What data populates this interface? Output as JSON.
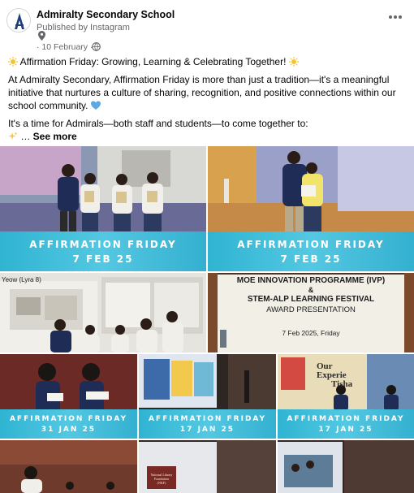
{
  "post": {
    "author": "Admiralty Secondary School",
    "publisher": "Published by Instagram",
    "date": "· 10 February ·",
    "more_icon": "more-options-icon",
    "paragraph_1": "Affirmation Friday: Growing, Learning & Celebrating Together!",
    "paragraph_2": "At Admiralty Secondary, Affirmation Friday is more than just a tradition—it's a meaningful initiative that nurtures a culture of sharing, recognition, and positive connections within our school community.",
    "paragraph_3": "It's a time for Admirals—both staff and students—to come together to:",
    "ellipsis": " … ",
    "see_more": "See more"
  },
  "photos": {
    "photo_1": {
      "banner_title": "AFFIRMATION FRIDAY",
      "banner_date": "7 FEB 25"
    },
    "photo_2": {
      "banner_title": "AFFIRMATION FRIDAY",
      "banner_date": "7 FEB 25"
    },
    "photo_3": {
      "caption": "Yeow (Lyra 8)"
    },
    "photo_4": {
      "line_1": "MOE INNOVATION PROGRAMME (IVP)",
      "line_2": "&",
      "line_3": "STEM-ALP LEARNING FESTIVAL",
      "line_4": "AWARD PRESENTATION",
      "line_5": "7 Feb 2025, Friday"
    },
    "photo_5": {
      "banner_title": "AFFIRMATION FRIDAY",
      "banner_date": "31 JAN 25"
    },
    "photo_6": {
      "banner_title": "AFFIRMATION FRIDAY",
      "banner_date": "17 JAN 25"
    },
    "photo_7": {
      "banner_title": "AFFIRMATION FRIDAY",
      "banner_date": "17 JAN 25",
      "slide_text_1": "Our",
      "slide_text_2": "Experie",
      "slide_text_3": "Tisha"
    },
    "photo_9": {
      "slide_text_1": "National Library",
      "slide_text_2": "Foundation",
      "slide_text_3": "(NKF)"
    }
  },
  "colors": {
    "banner": "#3cbbd8",
    "banner_text_dark": "#1d3e78",
    "link": "#65676b"
  }
}
